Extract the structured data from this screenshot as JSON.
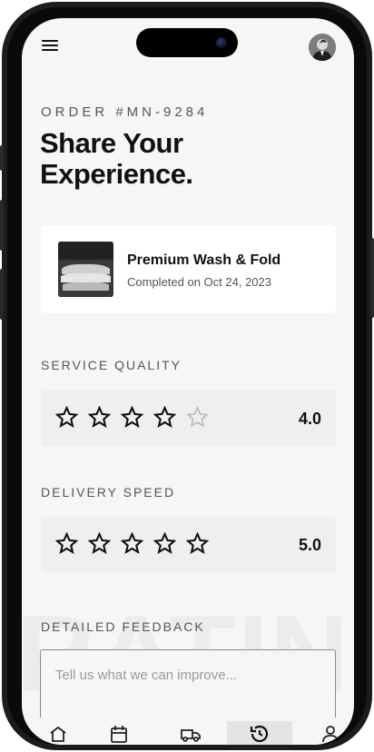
{
  "order": {
    "label": "ORDER #MN-9284"
  },
  "headline": {
    "line1": "Share Your",
    "line2": "Experience."
  },
  "service_card": {
    "title": "Premium Wash & Fold",
    "subtitle": "Completed on Oct 24, 2023"
  },
  "service_quality": {
    "label": "SERVICE QUALITY",
    "rating": 4,
    "value_text": "4.0"
  },
  "delivery_speed": {
    "label": "DELIVERY SPEED",
    "rating": 5,
    "value_text": "5.0"
  },
  "feedback": {
    "label": "DETAILED FEEDBACK",
    "placeholder": "Tell us what we can improve..."
  },
  "watermark_text": "RATING",
  "bottom_nav": {
    "items": [
      "home-icon",
      "calendar-icon",
      "truck-icon",
      "history-icon",
      "profile-icon"
    ],
    "active": "history-icon"
  },
  "colors": {
    "background": "#f6f6f6",
    "card": "#ffffff",
    "rating_box": "#efefef",
    "text_primary": "#111111",
    "text_secondary": "#555555",
    "star_inactive": "#bcbcbc"
  }
}
